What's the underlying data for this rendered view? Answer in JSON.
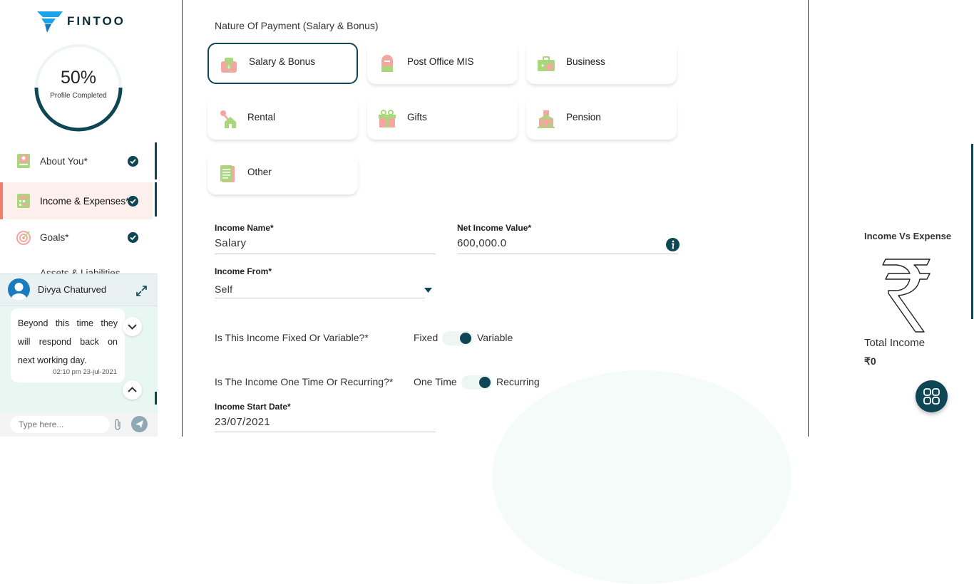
{
  "brand": {
    "name": "FINTOO"
  },
  "profile": {
    "percent": "50%",
    "label": "Profile Completed"
  },
  "sidebar": {
    "items": [
      {
        "label": "About You*",
        "completed": true
      },
      {
        "label": "Income & Expenses*",
        "completed": true,
        "active": true
      },
      {
        "label": "Goals*",
        "completed": true
      },
      {
        "label": "Assets & Liabilities",
        "completed": false
      }
    ]
  },
  "chat": {
    "agent_name": "Divya Chaturved",
    "message": "Beyond this time they will respond back on next working day.",
    "time": "02:10 pm 23-jul-2021",
    "input_placeholder": "Type here..."
  },
  "form": {
    "section_title": "Nature Of Payment (Salary & Bonus)",
    "payment_types": [
      {
        "label": "Salary & Bonus",
        "selected": true
      },
      {
        "label": "Post Office MIS",
        "selected": false
      },
      {
        "label": "Business",
        "selected": false
      },
      {
        "label": "Rental",
        "selected": false
      },
      {
        "label": "Gifts",
        "selected": false
      },
      {
        "label": "Pension",
        "selected": false
      },
      {
        "label": "Other",
        "selected": false
      }
    ],
    "income_name": {
      "label": "Income Name*",
      "value": "Salary"
    },
    "net_income": {
      "label": "Net Income Value*",
      "value": "600,000.0"
    },
    "income_from": {
      "label": "Income From*",
      "value": "Self"
    },
    "fixed_variable": {
      "question": "Is This Income Fixed Or Variable?*",
      "left": "Fixed",
      "right": "Variable",
      "selected": "Variable"
    },
    "one_time_recurring": {
      "question": "Is The Income One Time Or Recurring?*",
      "left": "One Time",
      "right": "Recurring",
      "selected": "Recurring"
    },
    "start_date": {
      "label": "Income Start Date*",
      "value": "23/07/2021"
    }
  },
  "summary": {
    "title": "Income Vs Expense",
    "total_label": "Total Income",
    "total_value": "₹0"
  },
  "colors": {
    "primary": "#0e4655",
    "accent": "#f27f6a",
    "active_bg": "#fdf0ec"
  }
}
